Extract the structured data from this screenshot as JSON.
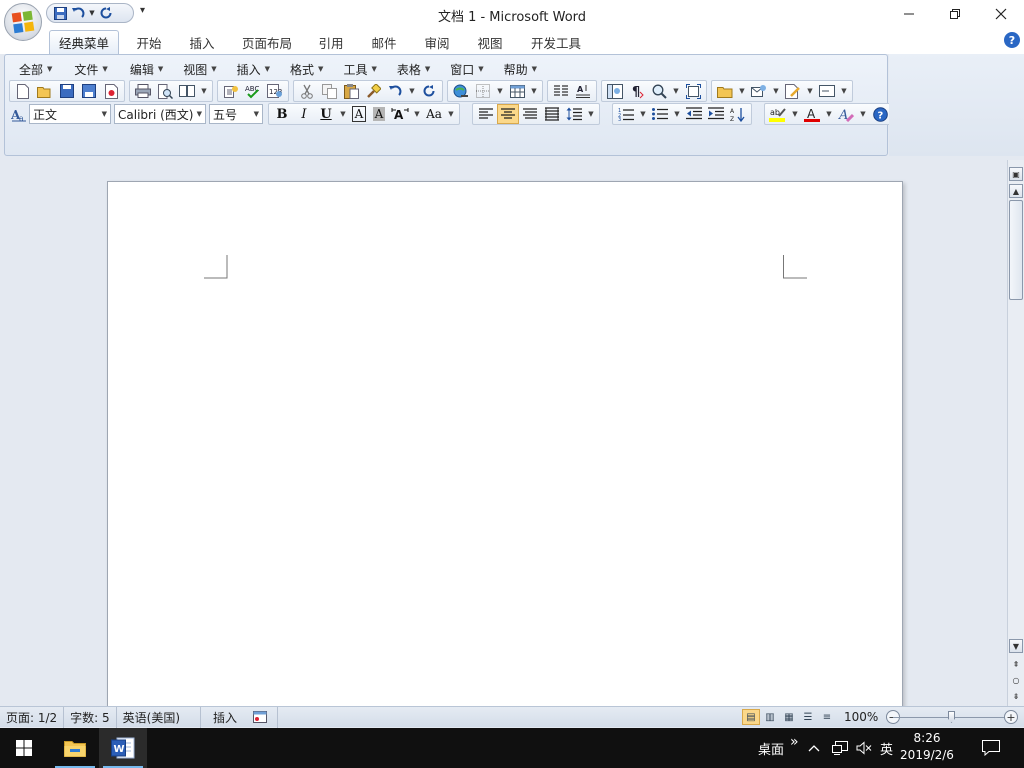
{
  "window": {
    "title": "文档 1 - Microsoft Word",
    "minimize_icon": "minimize-icon",
    "restore_icon": "restore-icon",
    "close_icon": "close-icon"
  },
  "ribbon_tabs": [
    "经典菜单",
    "开始",
    "插入",
    "页面布局",
    "引用",
    "邮件",
    "审阅",
    "视图",
    "开发工具"
  ],
  "active_tab": "经典菜单",
  "classic_menu": [
    "全部",
    "文件",
    "编辑",
    "视图",
    "插入",
    "格式",
    "工具",
    "表格",
    "窗口",
    "帮助"
  ],
  "format_toolbar": {
    "style": "正文",
    "font": "Calibri (西文)",
    "size": "五号",
    "bold": "B",
    "italic": "I",
    "underline": "U",
    "char_border": "A",
    "char_shading": "A",
    "change_case": "Aa"
  },
  "document": {},
  "status": {
    "page": "页面: 1/2",
    "words": "字数: 5",
    "language": "英语(美国)",
    "mode": "插入",
    "zoom": "100%"
  },
  "taskbar": {
    "desktop": "桌面",
    "chevron": "»",
    "ime": "英",
    "time": "8:26",
    "date": "2019/2/6"
  },
  "colors": {
    "ribbon": "#dfe7f2",
    "accent": "#2a67c4",
    "highlight_yellow": "#ffff00",
    "font_red": "#e00000",
    "taskbar": "#101010"
  }
}
